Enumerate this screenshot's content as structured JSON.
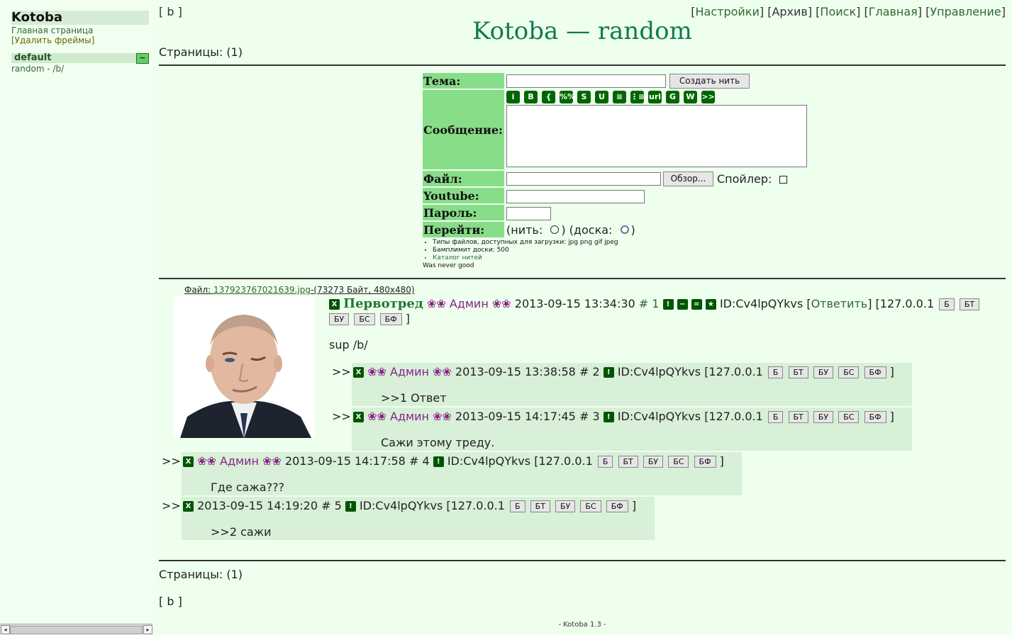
{
  "sidebar": {
    "title": "Kotoba",
    "home": "Главная страница",
    "delete_frames": "[Удалить фреймы]",
    "category": "default",
    "collapse": "−",
    "board": "random - /b/"
  },
  "nav": {
    "board_link": "[ b ]",
    "settings": "Настройки",
    "archive": "Архив",
    "search": "Поиск",
    "main": "Главная",
    "manage": "Управление"
  },
  "title": "Kotoba — random",
  "pages_label": "Страницы: (1)",
  "form": {
    "subject_label": "Тема:",
    "submit": "Создать нить",
    "message_label": "Сообщение:",
    "format_buttons": [
      "i",
      "B",
      "{ }",
      "%%",
      "S",
      "U",
      "≡",
      "⋮≡",
      "url",
      "G",
      "W",
      ">>"
    ],
    "file_label": "Файл:",
    "browse": "Обзор...",
    "spoiler_label": "Спойлер:",
    "youtube_label": "Youtube:",
    "password_label": "Пароль:",
    "goto_label": "Перейти:",
    "goto_thread": "(нить:",
    "goto_board": "(доска:",
    "notes": [
      "Типы файлов, доступных для загрузки: jpg png gif jpeg",
      "Бамплимит доски: 500",
      "Каталог нитей"
    ],
    "motto": "Was never good"
  },
  "thread": {
    "file_prefix": "Файл:",
    "file_name": "137923767021639.jpg",
    "file_info": "-(73273 Байт, 480x480)",
    "subject": "Первотред",
    "name": "❀❀ Админ ❀❀",
    "date": "2013-09-15 13:34:30",
    "num": "# 1",
    "id": "ID:Cv4lpQYkvs",
    "reply_link": "Ответить",
    "ip": "[127.0.0.1",
    "text": "sup /b/"
  },
  "mod_buttons": [
    "Б",
    "БТ",
    "БУ",
    "БС",
    "БФ"
  ],
  "replies": [
    {
      "name": "❀❀ Админ ❀❀",
      "date": "2013-09-15 13:38:58",
      "num": "# 2",
      "id": "ID:Cv4lpQYkvs [127.0.0.1",
      "text": ">>1 Ответ"
    },
    {
      "name": "❀❀ Админ ❀❀",
      "date": "2013-09-15 14:17:45",
      "num": "# 3",
      "id": "ID:Cv4lpQYkvs [127.0.0.1",
      "text": "Сажи этому треду."
    },
    {
      "name": "❀❀ Админ ❀❀",
      "date": "2013-09-15 14:17:58",
      "num": "# 4",
      "id": "ID:Cv4lpQYkvs [127.0.0.1",
      "text": "Где сажа???"
    },
    {
      "name": "",
      "date": "2013-09-15 14:19:20",
      "num": "# 5",
      "id": "ID:Cv4lpQYkvs [127.0.0.1",
      "text": ">>2 сажи"
    }
  ],
  "reply_arrow": ">>",
  "close_bracket": "]",
  "footer": "- Kotoba 1.3 -"
}
